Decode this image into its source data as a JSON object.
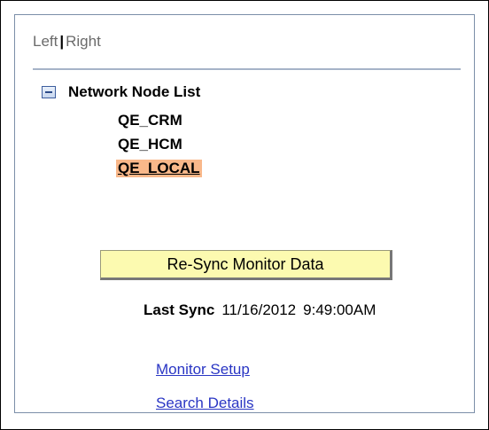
{
  "toggle": {
    "left_label": "Left",
    "separator": "|",
    "right_label": "Right"
  },
  "tree": {
    "root_label": "Network Node List",
    "nodes": [
      {
        "label": "QE_CRM",
        "selected": false
      },
      {
        "label": "QE_HCM",
        "selected": false
      },
      {
        "label": "QE_LOCAL",
        "selected": true
      }
    ]
  },
  "actions": {
    "resync_label": "Re-Sync Monitor Data"
  },
  "sync": {
    "label": "Last Sync",
    "date": "11/16/2012",
    "time": "9:49:00AM"
  },
  "links": [
    {
      "label": "Monitor Setup"
    },
    {
      "label": "Search Details"
    }
  ],
  "colors": {
    "selected_highlight": "#f9b88a",
    "button_bg": "#fcfab0",
    "link": "#2a36c4",
    "divider": "#a6b3c8"
  }
}
